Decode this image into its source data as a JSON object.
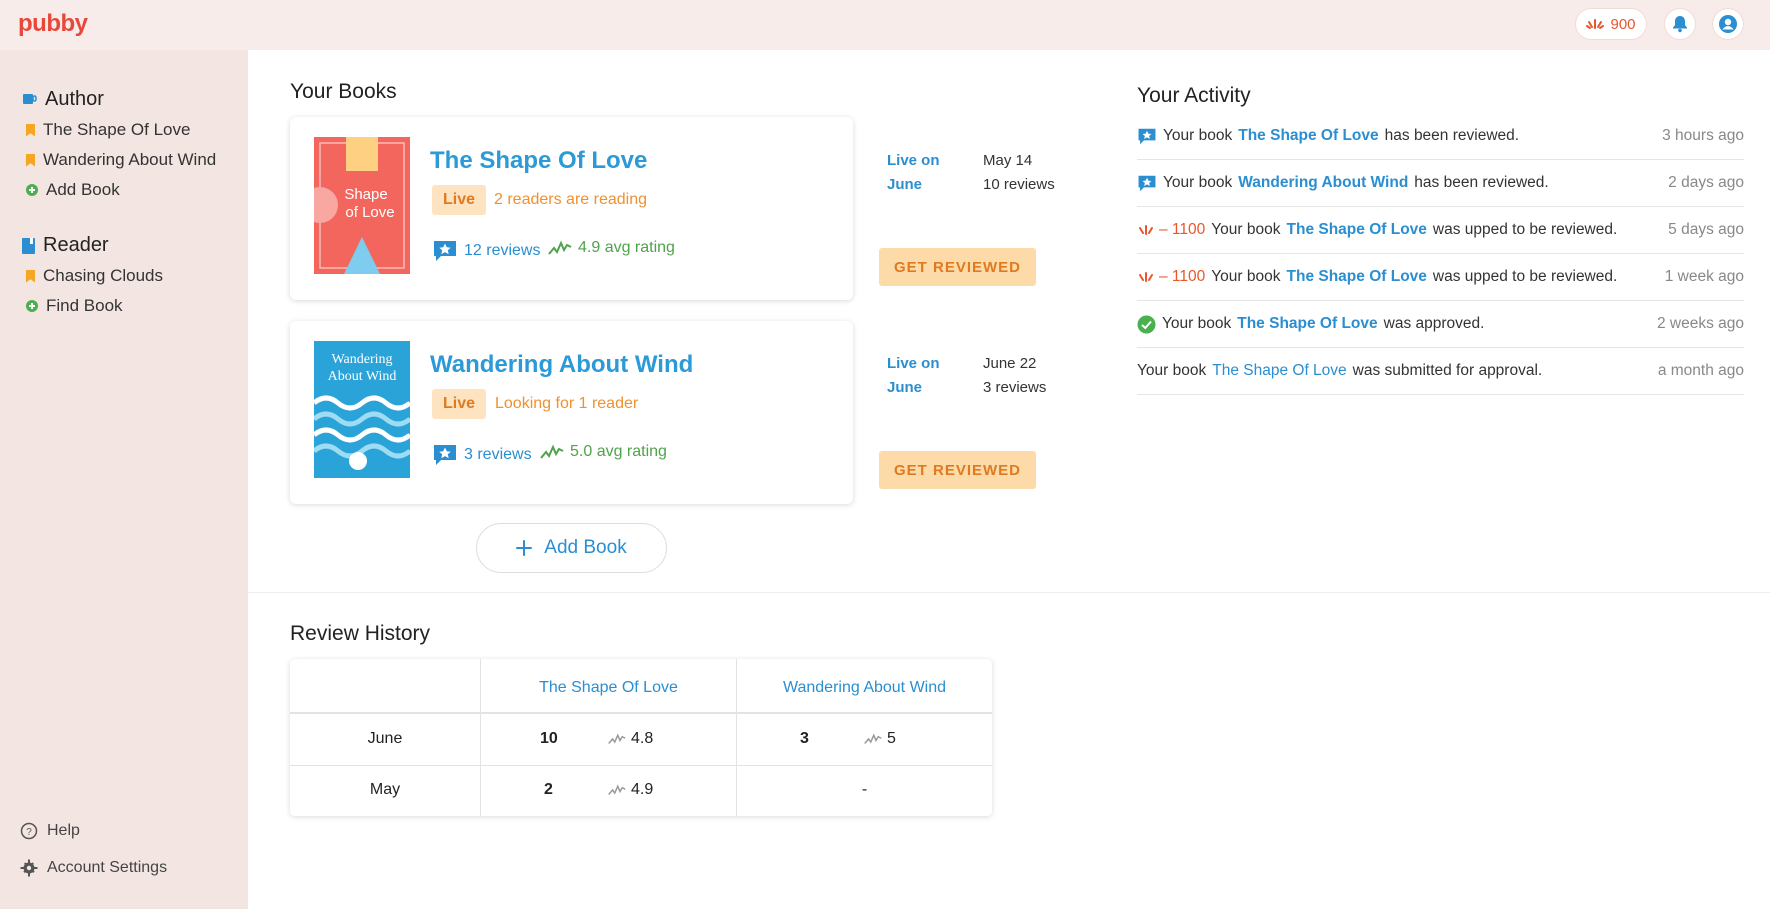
{
  "app": {
    "logo": "pubby"
  },
  "topbar": {
    "points": "900"
  },
  "sidebar": {
    "author_label": "Author",
    "author_items": [
      "The Shape Of Love",
      "Wandering About Wind"
    ],
    "author_add": "Add Book",
    "reader_label": "Reader",
    "reader_items": [
      "Chasing Clouds"
    ],
    "reader_find": "Find Book",
    "help": "Help",
    "settings": "Account Settings"
  },
  "books": {
    "heading": "Your Books",
    "items": [
      {
        "cover_text": "Shape of Love",
        "title": "The Shape Of Love",
        "status": "Live",
        "reading": "2 readers are reading",
        "reviews": "12 reviews",
        "rating": "4.9 avg rating",
        "live_on_label": "Live on",
        "live_on_date": "May 14",
        "month_label": "June",
        "month_reviews": "10 reviews",
        "cta": "GET REVIEWED"
      },
      {
        "cover_text": "Wandering About Wind",
        "title": "Wandering About Wind",
        "status": "Live",
        "reading": "Looking for 1 reader",
        "reviews": "3 reviews",
        "rating": "5.0 avg rating",
        "live_on_label": "Live on",
        "live_on_date": "June 22",
        "month_label": "June",
        "month_reviews": "3 reviews",
        "cta": "GET REVIEWED"
      }
    ],
    "add_book": "Add Book"
  },
  "activity": {
    "heading": "Your Activity",
    "rows": [
      {
        "icon": "review-star-icon",
        "points": "",
        "prefix": "Your book",
        "book": "The Shape Of Love",
        "suffix": "has been reviewed.",
        "time": "3 hours ago"
      },
      {
        "icon": "review-star-icon",
        "points": "",
        "prefix": "Your book",
        "book": "Wandering About Wind",
        "suffix": "has been reviewed.",
        "time": "2 days ago"
      },
      {
        "icon": "points-icon",
        "points": "– 1100",
        "prefix": "Your book",
        "book": "The Shape Of Love",
        "suffix": "was upped to be reviewed.",
        "time": "5 days ago"
      },
      {
        "icon": "points-icon",
        "points": "– 1100",
        "prefix": "Your book",
        "book": "The Shape Of Love",
        "suffix": "was upped to be reviewed.",
        "time": "1 week ago"
      },
      {
        "icon": "check-circle-icon",
        "points": "",
        "prefix": "Your book",
        "book": "The Shape Of Love",
        "suffix": "was approved.",
        "time": "2 weeks ago"
      },
      {
        "icon": "",
        "points": "",
        "prefix": "Your book",
        "book": "The Shape Of Love",
        "suffix": "was submitted for approval.",
        "time": "a month ago"
      }
    ]
  },
  "review_history": {
    "heading": "Review History",
    "columns": [
      "The Shape Of Love",
      "Wandering About Wind"
    ],
    "rows": [
      {
        "month": "June",
        "c1_reviews": "10",
        "c1_rating": "4.8",
        "c2_reviews": "3",
        "c2_rating": "5"
      },
      {
        "month": "May",
        "c1_reviews": "2",
        "c1_rating": "4.9",
        "c2_empty": "-"
      }
    ]
  },
  "colors": {
    "accent": "#2b8ed1",
    "brand": "#e8483b",
    "live": "#f0902e",
    "rating": "#4fa34a",
    "sidebar": "#f3e6e2"
  }
}
